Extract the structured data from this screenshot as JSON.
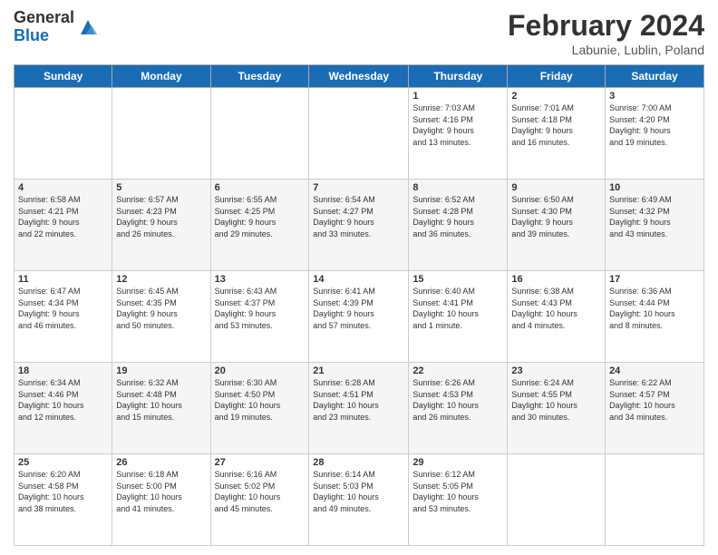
{
  "logo": {
    "general": "General",
    "blue": "Blue"
  },
  "header": {
    "month": "February 2024",
    "location": "Labunie, Lublin, Poland"
  },
  "weekdays": [
    "Sunday",
    "Monday",
    "Tuesday",
    "Wednesday",
    "Thursday",
    "Friday",
    "Saturday"
  ],
  "weeks": [
    [
      {
        "day": "",
        "info": ""
      },
      {
        "day": "",
        "info": ""
      },
      {
        "day": "",
        "info": ""
      },
      {
        "day": "",
        "info": ""
      },
      {
        "day": "1",
        "info": "Sunrise: 7:03 AM\nSunset: 4:16 PM\nDaylight: 9 hours\nand 13 minutes."
      },
      {
        "day": "2",
        "info": "Sunrise: 7:01 AM\nSunset: 4:18 PM\nDaylight: 9 hours\nand 16 minutes."
      },
      {
        "day": "3",
        "info": "Sunrise: 7:00 AM\nSunset: 4:20 PM\nDaylight: 9 hours\nand 19 minutes."
      }
    ],
    [
      {
        "day": "4",
        "info": "Sunrise: 6:58 AM\nSunset: 4:21 PM\nDaylight: 9 hours\nand 22 minutes."
      },
      {
        "day": "5",
        "info": "Sunrise: 6:57 AM\nSunset: 4:23 PM\nDaylight: 9 hours\nand 26 minutes."
      },
      {
        "day": "6",
        "info": "Sunrise: 6:55 AM\nSunset: 4:25 PM\nDaylight: 9 hours\nand 29 minutes."
      },
      {
        "day": "7",
        "info": "Sunrise: 6:54 AM\nSunset: 4:27 PM\nDaylight: 9 hours\nand 33 minutes."
      },
      {
        "day": "8",
        "info": "Sunrise: 6:52 AM\nSunset: 4:28 PM\nDaylight: 9 hours\nand 36 minutes."
      },
      {
        "day": "9",
        "info": "Sunrise: 6:50 AM\nSunset: 4:30 PM\nDaylight: 9 hours\nand 39 minutes."
      },
      {
        "day": "10",
        "info": "Sunrise: 6:49 AM\nSunset: 4:32 PM\nDaylight: 9 hours\nand 43 minutes."
      }
    ],
    [
      {
        "day": "11",
        "info": "Sunrise: 6:47 AM\nSunset: 4:34 PM\nDaylight: 9 hours\nand 46 minutes."
      },
      {
        "day": "12",
        "info": "Sunrise: 6:45 AM\nSunset: 4:35 PM\nDaylight: 9 hours\nand 50 minutes."
      },
      {
        "day": "13",
        "info": "Sunrise: 6:43 AM\nSunset: 4:37 PM\nDaylight: 9 hours\nand 53 minutes."
      },
      {
        "day": "14",
        "info": "Sunrise: 6:41 AM\nSunset: 4:39 PM\nDaylight: 9 hours\nand 57 minutes."
      },
      {
        "day": "15",
        "info": "Sunrise: 6:40 AM\nSunset: 4:41 PM\nDaylight: 10 hours\nand 1 minute."
      },
      {
        "day": "16",
        "info": "Sunrise: 6:38 AM\nSunset: 4:43 PM\nDaylight: 10 hours\nand 4 minutes."
      },
      {
        "day": "17",
        "info": "Sunrise: 6:36 AM\nSunset: 4:44 PM\nDaylight: 10 hours\nand 8 minutes."
      }
    ],
    [
      {
        "day": "18",
        "info": "Sunrise: 6:34 AM\nSunset: 4:46 PM\nDaylight: 10 hours\nand 12 minutes."
      },
      {
        "day": "19",
        "info": "Sunrise: 6:32 AM\nSunset: 4:48 PM\nDaylight: 10 hours\nand 15 minutes."
      },
      {
        "day": "20",
        "info": "Sunrise: 6:30 AM\nSunset: 4:50 PM\nDaylight: 10 hours\nand 19 minutes."
      },
      {
        "day": "21",
        "info": "Sunrise: 6:28 AM\nSunset: 4:51 PM\nDaylight: 10 hours\nand 23 minutes."
      },
      {
        "day": "22",
        "info": "Sunrise: 6:26 AM\nSunset: 4:53 PM\nDaylight: 10 hours\nand 26 minutes."
      },
      {
        "day": "23",
        "info": "Sunrise: 6:24 AM\nSunset: 4:55 PM\nDaylight: 10 hours\nand 30 minutes."
      },
      {
        "day": "24",
        "info": "Sunrise: 6:22 AM\nSunset: 4:57 PM\nDaylight: 10 hours\nand 34 minutes."
      }
    ],
    [
      {
        "day": "25",
        "info": "Sunrise: 6:20 AM\nSunset: 4:58 PM\nDaylight: 10 hours\nand 38 minutes."
      },
      {
        "day": "26",
        "info": "Sunrise: 6:18 AM\nSunset: 5:00 PM\nDaylight: 10 hours\nand 41 minutes."
      },
      {
        "day": "27",
        "info": "Sunrise: 6:16 AM\nSunset: 5:02 PM\nDaylight: 10 hours\nand 45 minutes."
      },
      {
        "day": "28",
        "info": "Sunrise: 6:14 AM\nSunset: 5:03 PM\nDaylight: 10 hours\nand 49 minutes."
      },
      {
        "day": "29",
        "info": "Sunrise: 6:12 AM\nSunset: 5:05 PM\nDaylight: 10 hours\nand 53 minutes."
      },
      {
        "day": "",
        "info": ""
      },
      {
        "day": "",
        "info": ""
      }
    ]
  ]
}
